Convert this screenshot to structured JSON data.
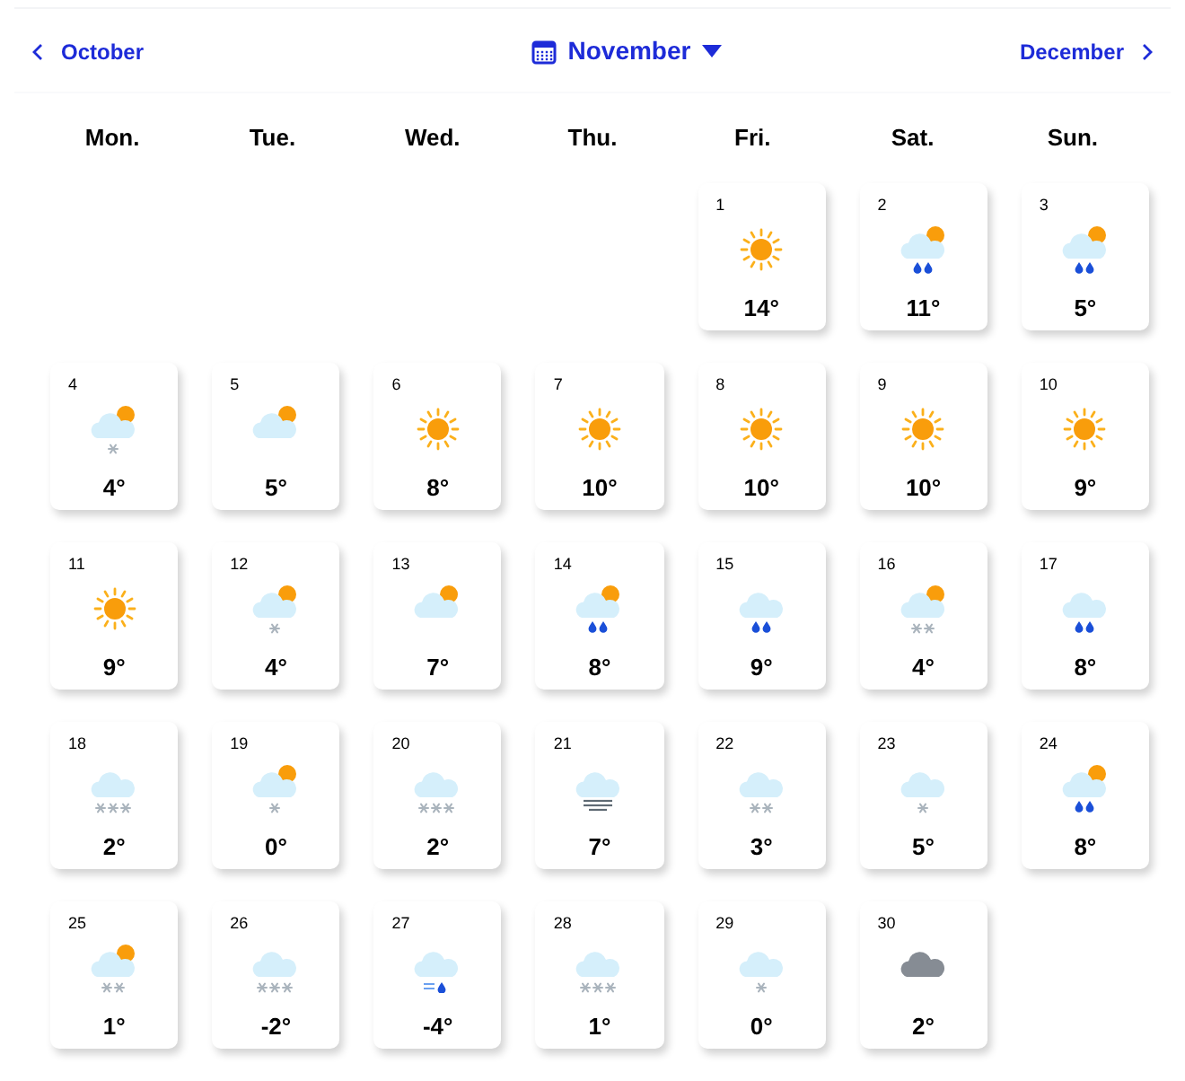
{
  "nav": {
    "previous": "October",
    "current": "November",
    "next": "December"
  },
  "weekdays": [
    "Mon.",
    "Tue.",
    "Wed.",
    "Thu.",
    "Fri.",
    "Sat.",
    "Sun."
  ],
  "days": [
    {
      "date": "1",
      "kind": "sunny",
      "temp": "14°"
    },
    {
      "date": "2",
      "kind": "rainsun",
      "temp": "11°"
    },
    {
      "date": "3",
      "kind": "rainsun",
      "temp": "5°"
    },
    {
      "date": "4",
      "kind": "snow1sun",
      "temp": "4°"
    },
    {
      "date": "5",
      "kind": "cloudsun",
      "temp": "5°"
    },
    {
      "date": "6",
      "kind": "sunny",
      "temp": "8°"
    },
    {
      "date": "7",
      "kind": "sunny",
      "temp": "10°"
    },
    {
      "date": "8",
      "kind": "sunny",
      "temp": "10°"
    },
    {
      "date": "9",
      "kind": "sunny",
      "temp": "10°"
    },
    {
      "date": "10",
      "kind": "sunny",
      "temp": "9°"
    },
    {
      "date": "11",
      "kind": "sunny",
      "temp": "9°"
    },
    {
      "date": "12",
      "kind": "snow1sun",
      "temp": "4°"
    },
    {
      "date": "13",
      "kind": "cloudsun",
      "temp": "7°"
    },
    {
      "date": "14",
      "kind": "rainsun",
      "temp": "8°"
    },
    {
      "date": "15",
      "kind": "rain",
      "temp": "9°"
    },
    {
      "date": "16",
      "kind": "snow2sun",
      "temp": "4°"
    },
    {
      "date": "17",
      "kind": "rain",
      "temp": "8°"
    },
    {
      "date": "18",
      "kind": "snow3",
      "temp": "2°"
    },
    {
      "date": "19",
      "kind": "snow1sun",
      "temp": "0°"
    },
    {
      "date": "20",
      "kind": "snow3",
      "temp": "2°"
    },
    {
      "date": "21",
      "kind": "fog",
      "temp": "7°"
    },
    {
      "date": "22",
      "kind": "snow2",
      "temp": "3°"
    },
    {
      "date": "23",
      "kind": "snow1",
      "temp": "5°"
    },
    {
      "date": "24",
      "kind": "rainsun",
      "temp": "8°"
    },
    {
      "date": "25",
      "kind": "snow2sun",
      "temp": "1°"
    },
    {
      "date": "26",
      "kind": "snow3",
      "temp": "-2°"
    },
    {
      "date": "27",
      "kind": "sleet",
      "temp": "-4°"
    },
    {
      "date": "28",
      "kind": "snow3",
      "temp": "1°"
    },
    {
      "date": "29",
      "kind": "snow1",
      "temp": "0°"
    },
    {
      "date": "30",
      "kind": "overcast",
      "temp": "2°"
    }
  ]
}
